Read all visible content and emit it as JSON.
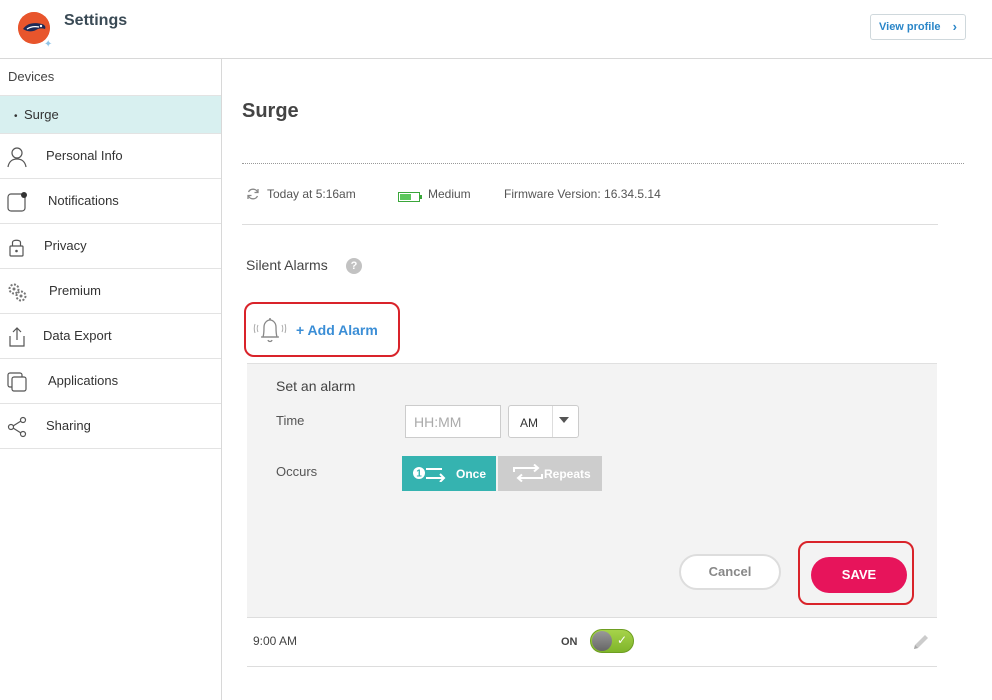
{
  "header": {
    "title": "Settings",
    "view_profile_label": "View profile",
    "chevron_glyph": "›"
  },
  "sidebar": {
    "section_label": "Devices",
    "device_item": "Surge",
    "bullet": "•",
    "items": [
      {
        "label": "Personal Info",
        "icon": "person-icon"
      },
      {
        "label": "Notifications",
        "icon": "notification-icon"
      },
      {
        "label": "Privacy",
        "icon": "lock-icon"
      },
      {
        "label": "Premium",
        "icon": "gears-icon"
      },
      {
        "label": "Data Export",
        "icon": "export-icon"
      },
      {
        "label": "Applications",
        "icon": "applications-icon"
      },
      {
        "label": "Sharing",
        "icon": "share-icon"
      }
    ]
  },
  "device": {
    "name": "Surge",
    "last_sync": "Today at 5:16am",
    "battery": "Medium",
    "firmware": "Firmware Version: 16.34.5.14"
  },
  "alarms": {
    "section_title": "Silent Alarms",
    "help_glyph": "?",
    "add_label": "+ Add Alarm",
    "panel": {
      "title": "Set an alarm",
      "time_label": "Time",
      "time_placeholder": "HH:MM",
      "ampm_value": "AM",
      "occurs_label": "Occurs",
      "once_label": "Once",
      "repeats_label": "Repeats",
      "cancel_label": "Cancel",
      "save_label": "SAVE"
    },
    "list": [
      {
        "time": "9:00 AM",
        "state_label": "ON",
        "enabled": true
      }
    ]
  },
  "colors": {
    "accent_teal": "#35b3b0",
    "save_pink": "#e7145b",
    "link_blue": "#3b8ed6",
    "selected_device_bg": "#d8f0f0",
    "annotation_red": "#d9232a",
    "toggle_green": "#8cc63f"
  }
}
